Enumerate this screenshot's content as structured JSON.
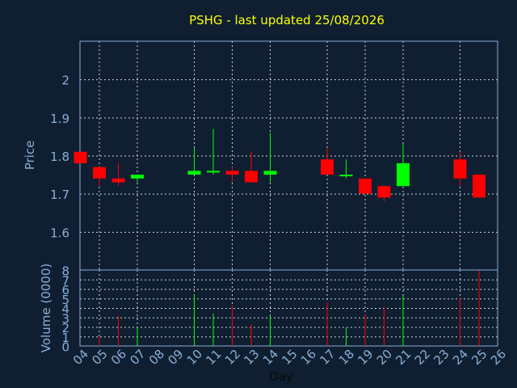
{
  "chart_data": [
    {
      "type": "candlestick",
      "title": "PSHG - last updated 25/08/2026",
      "ylabel": "Price",
      "ylim": [
        1.5,
        2.1
      ],
      "yticks": [
        1.6,
        1.7,
        1.8,
        1.9,
        2
      ],
      "ytick_labels": [
        "1.6",
        "1.7",
        "1.8",
        "1.9",
        "2"
      ],
      "grid": true,
      "colors": {
        "up": "#00ff00",
        "down": "#ff0000",
        "background": "#0f1f31",
        "text": "#8aaed8",
        "title": "#ffff00",
        "grid": "#c8d2dc"
      },
      "candles": [
        {
          "day": "04",
          "open": 1.81,
          "high": 1.81,
          "low": 1.78,
          "close": 1.78
        },
        {
          "day": "05",
          "open": 1.77,
          "high": 1.77,
          "low": 1.72,
          "close": 1.74
        },
        {
          "day": "06",
          "open": 1.74,
          "high": 1.78,
          "low": 1.72,
          "close": 1.73
        },
        {
          "day": "07",
          "open": 1.74,
          "high": 1.75,
          "low": 1.73,
          "close": 1.75
        },
        {
          "day": "10",
          "open": 1.75,
          "high": 1.82,
          "low": 1.75,
          "close": 1.76
        },
        {
          "day": "11",
          "open": 1.76,
          "high": 1.87,
          "low": 1.75,
          "close": 1.76
        },
        {
          "day": "12",
          "open": 1.76,
          "high": 1.77,
          "low": 1.73,
          "close": 1.75
        },
        {
          "day": "13",
          "open": 1.76,
          "high": 1.81,
          "low": 1.73,
          "close": 1.73
        },
        {
          "day": "14",
          "open": 1.75,
          "high": 1.86,
          "low": 1.73,
          "close": 1.76
        },
        {
          "day": "17",
          "open": 1.79,
          "high": 1.82,
          "low": 1.75,
          "close": 1.75
        },
        {
          "day": "18",
          "open": 1.75,
          "high": 1.79,
          "low": 1.74,
          "close": 1.75
        },
        {
          "day": "19",
          "open": 1.74,
          "high": 1.74,
          "low": 1.7,
          "close": 1.7
        },
        {
          "day": "20",
          "open": 1.72,
          "high": 1.72,
          "low": 1.68,
          "close": 1.69
        },
        {
          "day": "21",
          "open": 1.72,
          "high": 1.83,
          "low": 1.72,
          "close": 1.78
        },
        {
          "day": "24",
          "open": 1.79,
          "high": 1.81,
          "low": 1.72,
          "close": 1.74
        },
        {
          "day": "25",
          "open": 1.75,
          "high": 1.75,
          "low": 1.69,
          "close": 1.69
        }
      ]
    },
    {
      "type": "bar",
      "xlabel": "Day",
      "ylabel": "Volume (0000)",
      "ylim": [
        0,
        8
      ],
      "yticks": [
        0,
        1,
        2,
        3,
        4,
        5,
        6,
        7,
        8
      ],
      "ytick_labels": [
        "0",
        "1",
        "2",
        "3",
        "4",
        "5",
        "6",
        "7",
        "8"
      ],
      "grid": true,
      "x_tick_labels": [
        "04",
        "05",
        "06",
        "07",
        "08",
        "09",
        "10",
        "11",
        "12",
        "13",
        "14",
        "15",
        "16",
        "17",
        "18",
        "19",
        "20",
        "21",
        "22",
        "23",
        "24",
        "25",
        "26"
      ],
      "bars": [
        {
          "day": "05",
          "value": 1.0,
          "direction": "down"
        },
        {
          "day": "06",
          "value": 3.2,
          "direction": "down"
        },
        {
          "day": "07",
          "value": 2.0,
          "direction": "up"
        },
        {
          "day": "10",
          "value": 5.4,
          "direction": "up"
        },
        {
          "day": "11",
          "value": 3.4,
          "direction": "up"
        },
        {
          "day": "12",
          "value": 4.3,
          "direction": "down"
        },
        {
          "day": "13",
          "value": 2.3,
          "direction": "down"
        },
        {
          "day": "14",
          "value": 3.2,
          "direction": "up"
        },
        {
          "day": "17",
          "value": 4.6,
          "direction": "down"
        },
        {
          "day": "18",
          "value": 1.9,
          "direction": "up"
        },
        {
          "day": "19",
          "value": 3.3,
          "direction": "down"
        },
        {
          "day": "20",
          "value": 4.1,
          "direction": "down"
        },
        {
          "day": "21",
          "value": 5.3,
          "direction": "up"
        },
        {
          "day": "24",
          "value": 5.1,
          "direction": "down"
        },
        {
          "day": "25",
          "value": 7.9,
          "direction": "down"
        }
      ]
    }
  ]
}
